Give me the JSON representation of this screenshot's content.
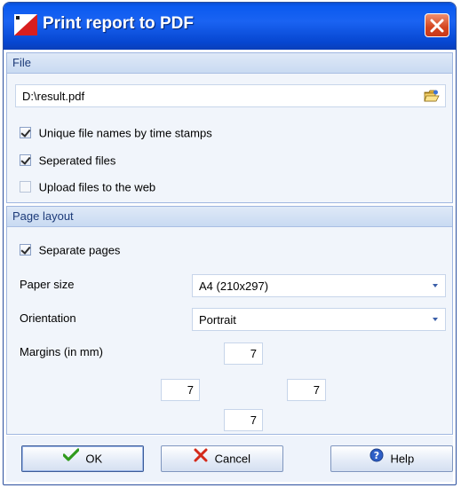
{
  "window": {
    "title": "Print report to PDF",
    "icon": "pdf-app-icon",
    "close_icon": "close-icon"
  },
  "file_section": {
    "header": "File",
    "path_value": "D:\\result.pdf",
    "browse_icon": "open-folder-icon",
    "options": [
      {
        "label": "Unique file names by time stamps",
        "checked": true
      },
      {
        "label": "Seperated files",
        "checked": true
      },
      {
        "label": "Upload files to the web",
        "checked": false
      }
    ]
  },
  "layout_section": {
    "header": "Page layout",
    "separate_pages": {
      "label": "Separate pages",
      "checked": true
    },
    "paper_size": {
      "label": "Paper size",
      "value": "A4 (210x297)"
    },
    "orientation": {
      "label": "Orientation",
      "value": "Portrait"
    },
    "margins": {
      "label": "Margins (in mm)",
      "top": "7",
      "left": "7",
      "right": "7",
      "bottom": "7"
    }
  },
  "buttons": {
    "ok": "OK",
    "cancel": "Cancel",
    "help": "Help"
  },
  "colors": {
    "titlebar": "#0b5af0",
    "panel_header_text": "#1d3b79",
    "close_button": "#d4451e"
  }
}
